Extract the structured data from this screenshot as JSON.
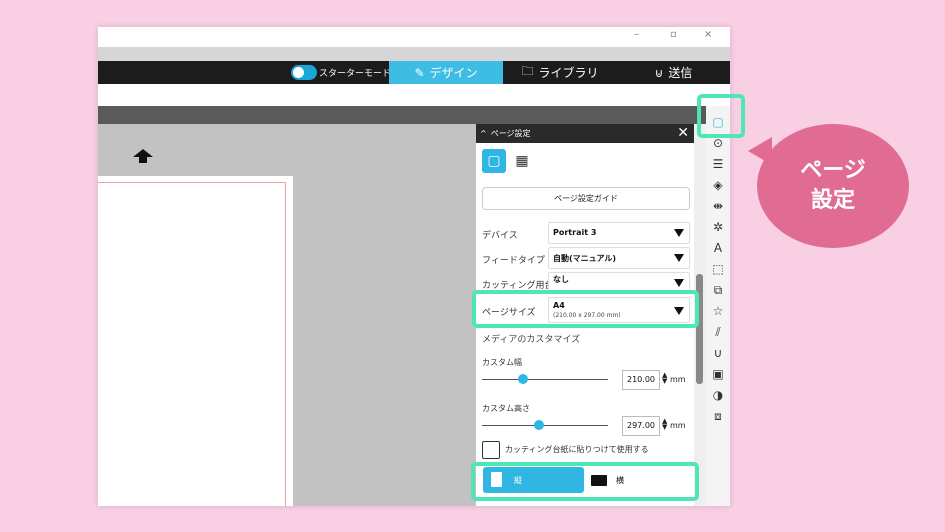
{
  "window": {
    "controls": {
      "minimize": "–",
      "restore": "▫",
      "close": "×"
    }
  },
  "topbar": {
    "starter_mode": "スターターモードオフ",
    "tabs": [
      {
        "label": "デザイン",
        "icon": "pencil-ruler-icon",
        "active": true
      },
      {
        "label": "ライブラリ",
        "icon": "folder-icon",
        "active": false
      },
      {
        "label": "送信",
        "icon": "magnet-icon",
        "active": false
      }
    ]
  },
  "panel": {
    "title": "ページ設定",
    "guide_button": "ページ設定ガイド",
    "rows": {
      "device": {
        "label": "デバイス",
        "value": "Portrait 3"
      },
      "feed": {
        "label": "フィードタイプ",
        "value": "自動(マニュアル)"
      },
      "cutting_mat": {
        "label": "カッティング用台紙",
        "value": "なし"
      },
      "page_size": {
        "label": "ページサイズ",
        "value": "A4",
        "sub": "(210.00 x 297.00 mm)"
      }
    },
    "media_title": "メディアのカスタマイズ",
    "custom_width": {
      "label": "カスタム幅",
      "value": "210.00",
      "unit": "mm"
    },
    "custom_height": {
      "label": "カスタム高さ",
      "value": "297.00",
      "unit": "mm"
    },
    "checkbox_label": "カッティング台紙に貼りつけて使用する",
    "orientation": {
      "portrait": "縦",
      "landscape": "横",
      "selected": "portrait"
    }
  },
  "callout": {
    "line1": "ページ",
    "line2": "設定"
  },
  "colors": {
    "accent": "#3dbde3",
    "highlight": "#4ee6b5",
    "callout": "#e06c93",
    "background": "#f9cfe3"
  }
}
